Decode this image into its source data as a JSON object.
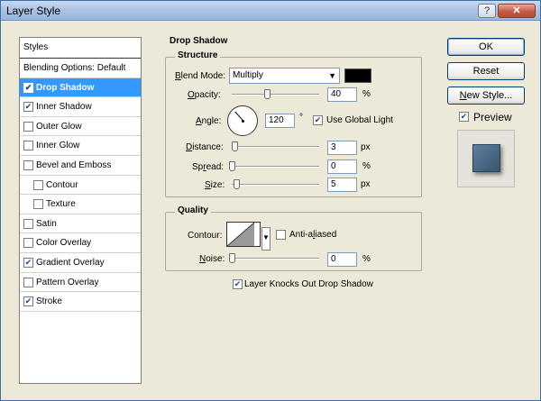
{
  "window": {
    "title": "Layer Style",
    "help_glyph": "?",
    "close_glyph": "✕"
  },
  "styles_panel": {
    "header": "Styles",
    "items": [
      {
        "label": "Blending Options: Default",
        "checked": null
      },
      {
        "label": "Drop Shadow",
        "checked": true,
        "selected": true
      },
      {
        "label": "Inner Shadow",
        "checked": true
      },
      {
        "label": "Outer Glow",
        "checked": false
      },
      {
        "label": "Inner Glow",
        "checked": false
      },
      {
        "label": "Bevel and Emboss",
        "checked": false
      },
      {
        "label": "Contour",
        "checked": false,
        "indent": true
      },
      {
        "label": "Texture",
        "checked": false,
        "indent": true
      },
      {
        "label": "Satin",
        "checked": false
      },
      {
        "label": "Color Overlay",
        "checked": false
      },
      {
        "label": "Gradient Overlay",
        "checked": true
      },
      {
        "label": "Pattern Overlay",
        "checked": false
      },
      {
        "label": "Stroke",
        "checked": true
      }
    ]
  },
  "drop_shadow": {
    "section_title": "Drop Shadow",
    "structure": {
      "title": "Structure",
      "blend_mode": {
        "label_pre": "",
        "label_u": "B",
        "label_post": "lend Mode:",
        "value": "Multiply",
        "color": "#000000"
      },
      "opacity": {
        "label_u": "O",
        "label_post": "pacity:",
        "value": "40",
        "unit": "%",
        "fraction": 0.4
      },
      "angle": {
        "label_u": "A",
        "label_post": "ngle:",
        "value": "120",
        "unit": "°",
        "use_global_light": true,
        "use_global_light_label": "Use Global Light"
      },
      "distance": {
        "label_u": "D",
        "label_post": "istance:",
        "value": "3",
        "unit": "px",
        "fraction": 0.0
      },
      "spread": {
        "label_pre": "Sp",
        "label_u": "r",
        "label_post": "ead:",
        "value": "0",
        "unit": "%",
        "fraction": 0.0
      },
      "size": {
        "label_u": "S",
        "label_post": "ize:",
        "value": "5",
        "unit": "px",
        "fraction": 0.02
      }
    },
    "quality": {
      "title": "Quality",
      "contour_label": "Contour:",
      "anti_aliased": {
        "label_pre": "Anti-a",
        "label_u": "l",
        "label_post": "iased",
        "checked": false
      },
      "noise": {
        "label_u": "N",
        "label_post": "oise:",
        "value": "0",
        "unit": "%",
        "fraction": 0.0
      }
    },
    "knockout": {
      "label": "Layer Knocks Out Drop Shadow",
      "checked": true
    }
  },
  "buttons": {
    "ok": "OK",
    "reset": "Reset",
    "new_style_u": "N",
    "new_style_post": "ew Style..."
  },
  "preview": {
    "label": "Preview",
    "checked": true,
    "swatch_color": "#4a6885"
  }
}
